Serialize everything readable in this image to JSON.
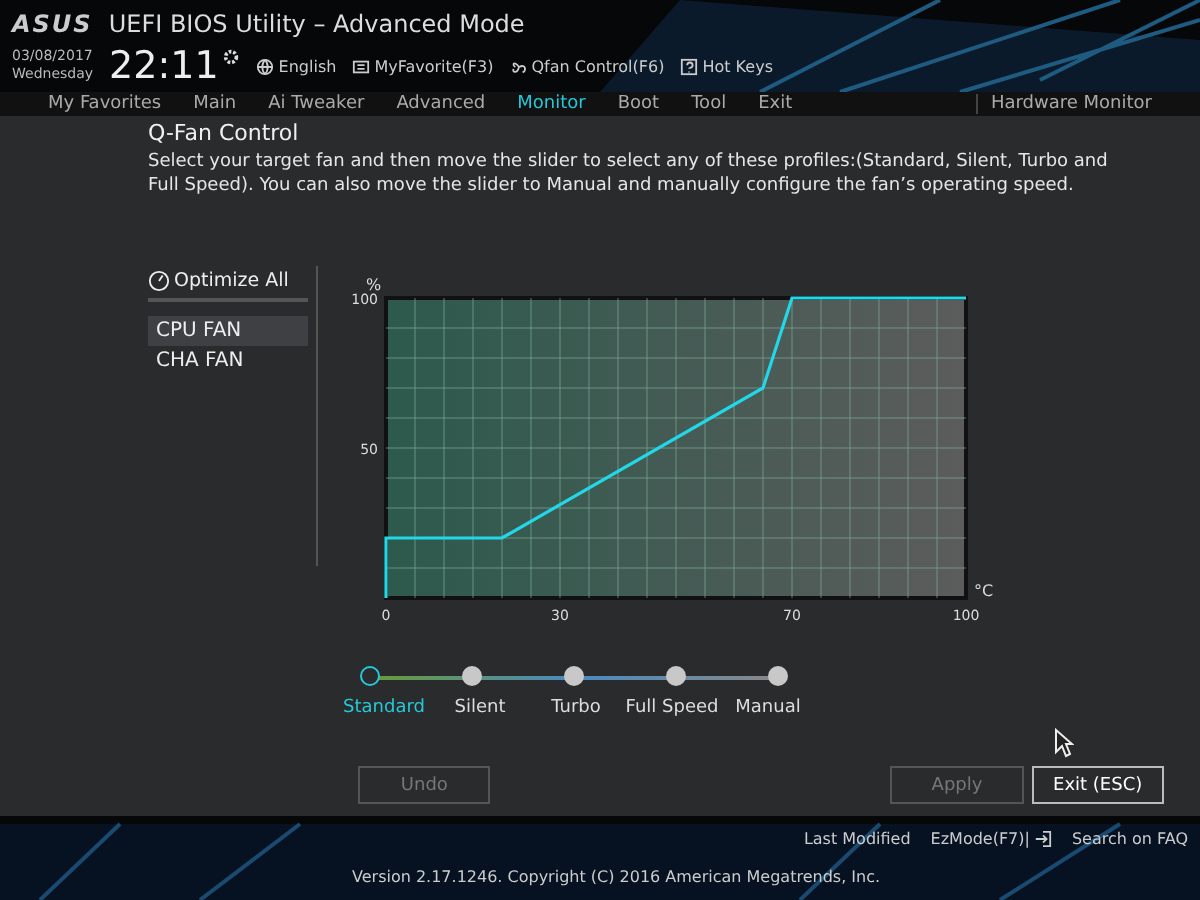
{
  "header": {
    "logo": "ASUS",
    "title": "UEFI BIOS Utility – Advanced Mode",
    "date": "03/08/2017",
    "weekday": "Wednesday",
    "time": "22:11",
    "tools": [
      {
        "kind": "globe",
        "label": "English"
      },
      {
        "kind": "favorite",
        "label": "MyFavorite(F3)"
      },
      {
        "kind": "fan",
        "label": "Qfan Control(F6)"
      },
      {
        "kind": "help",
        "label": "Hot Keys"
      }
    ]
  },
  "menu": [
    {
      "label": "My Favorites",
      "selected": false
    },
    {
      "label": "Main",
      "selected": false
    },
    {
      "label": "Ai Tweaker",
      "selected": false
    },
    {
      "label": "Advanced",
      "selected": false
    },
    {
      "label": "Monitor",
      "selected": true
    },
    {
      "label": "Boot",
      "selected": false
    },
    {
      "label": "Tool",
      "selected": false
    },
    {
      "label": "Exit",
      "selected": false
    }
  ],
  "hardware_monitor": "Hardware Monitor",
  "dialog": {
    "title": "Q-Fan Control",
    "description": "Select your target fan and then move the slider to select any of these profiles:(Standard, Silent, Turbo and Full Speed). You can also move the slider to Manual and manually configure the fan’s operating speed.",
    "optimize_all": "Optimize All",
    "fans": [
      {
        "label": "CPU FAN",
        "selected": true
      },
      {
        "label": "CHA FAN",
        "selected": false
      }
    ],
    "chart_data": {
      "type": "line",
      "xlabel": "°C",
      "ylabel": "%",
      "x": [
        0,
        0,
        20,
        65,
        70,
        100
      ],
      "series": [
        {
          "color": "#22d8e8",
          "values": [
            0,
            20,
            20,
            70,
            100,
            100
          ]
        }
      ],
      "grid": true,
      "xlim": [
        0,
        100
      ],
      "ylim": [
        0,
        100
      ],
      "xticks": [
        0,
        30,
        70,
        100
      ],
      "yticks": [
        50,
        100
      ]
    },
    "profiles": [
      {
        "label": "Standard",
        "selected": true
      },
      {
        "label": "Silent",
        "selected": false
      },
      {
        "label": "Turbo",
        "selected": false
      },
      {
        "label": "Full Speed",
        "selected": false
      },
      {
        "label": "Manual",
        "selected": false
      }
    ],
    "buttons": [
      {
        "label": "Undo",
        "disabled": true
      },
      {
        "label": "Apply",
        "disabled": true
      },
      {
        "label": "Exit (ESC)",
        "disabled": false
      }
    ]
  },
  "footer": {
    "links": [
      {
        "kind": "text",
        "label": "Last Modified"
      },
      {
        "kind": "exit",
        "label": "EzMode(F7)|"
      },
      {
        "kind": "text",
        "label": "Search on FAQ"
      }
    ],
    "version": "Version 2.17.1246. Copyright (C) 2016 American Megatrends, Inc."
  }
}
